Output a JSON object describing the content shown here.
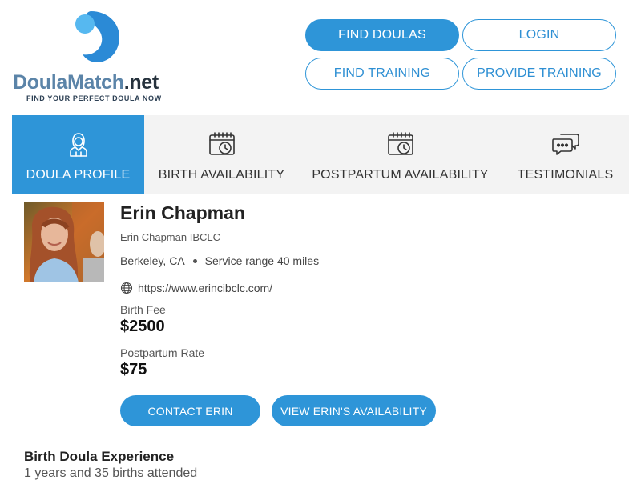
{
  "brand": {
    "name_part1": "Doula",
    "name_part2": "Match",
    "name_part3": ".net",
    "tagline": "FIND YOUR PERFECT DOULA NOW",
    "colors": {
      "logo_dark": "#2b8ad6",
      "logo_light": "#56b8f0",
      "text_blue": "#5b84a8"
    }
  },
  "header_nav": {
    "find_doulas": "FIND DOULAS",
    "login": "LOGIN",
    "find_training": "FIND TRAINING",
    "provide_training": "PROVIDE TRAINING"
  },
  "tabs": [
    {
      "label": "DOULA PROFILE",
      "icon": "doula-person-icon",
      "active": true
    },
    {
      "label": "BIRTH AVAILABILITY",
      "icon": "calendar-clock-icon",
      "active": false
    },
    {
      "label": "POSTPARTUM AVAILABILITY",
      "icon": "calendar-clock-icon",
      "active": false
    },
    {
      "label": "TESTIMONIALS",
      "icon": "chat-bubbles-icon",
      "active": false
    }
  ],
  "profile": {
    "name": "Erin Chapman",
    "credential": "Erin Chapman IBCLC",
    "location": "Berkeley, CA",
    "service_range": "Service range 40 miles",
    "website": "https://www.erincibclc.com/",
    "birth_fee_label": "Birth Fee",
    "birth_fee": "$2500",
    "postpartum_rate_label": "Postpartum Rate",
    "postpartum_rate": "$75",
    "contact_button": "CONTACT ERIN",
    "availability_button": "VIEW ERIN'S AVAILABILITY"
  },
  "experience": {
    "title": "Birth Doula Experience",
    "text": "1 years and 35 births attended"
  },
  "colors": {
    "accent": "#2e95d8",
    "tab_bg": "#f3f3f3"
  }
}
